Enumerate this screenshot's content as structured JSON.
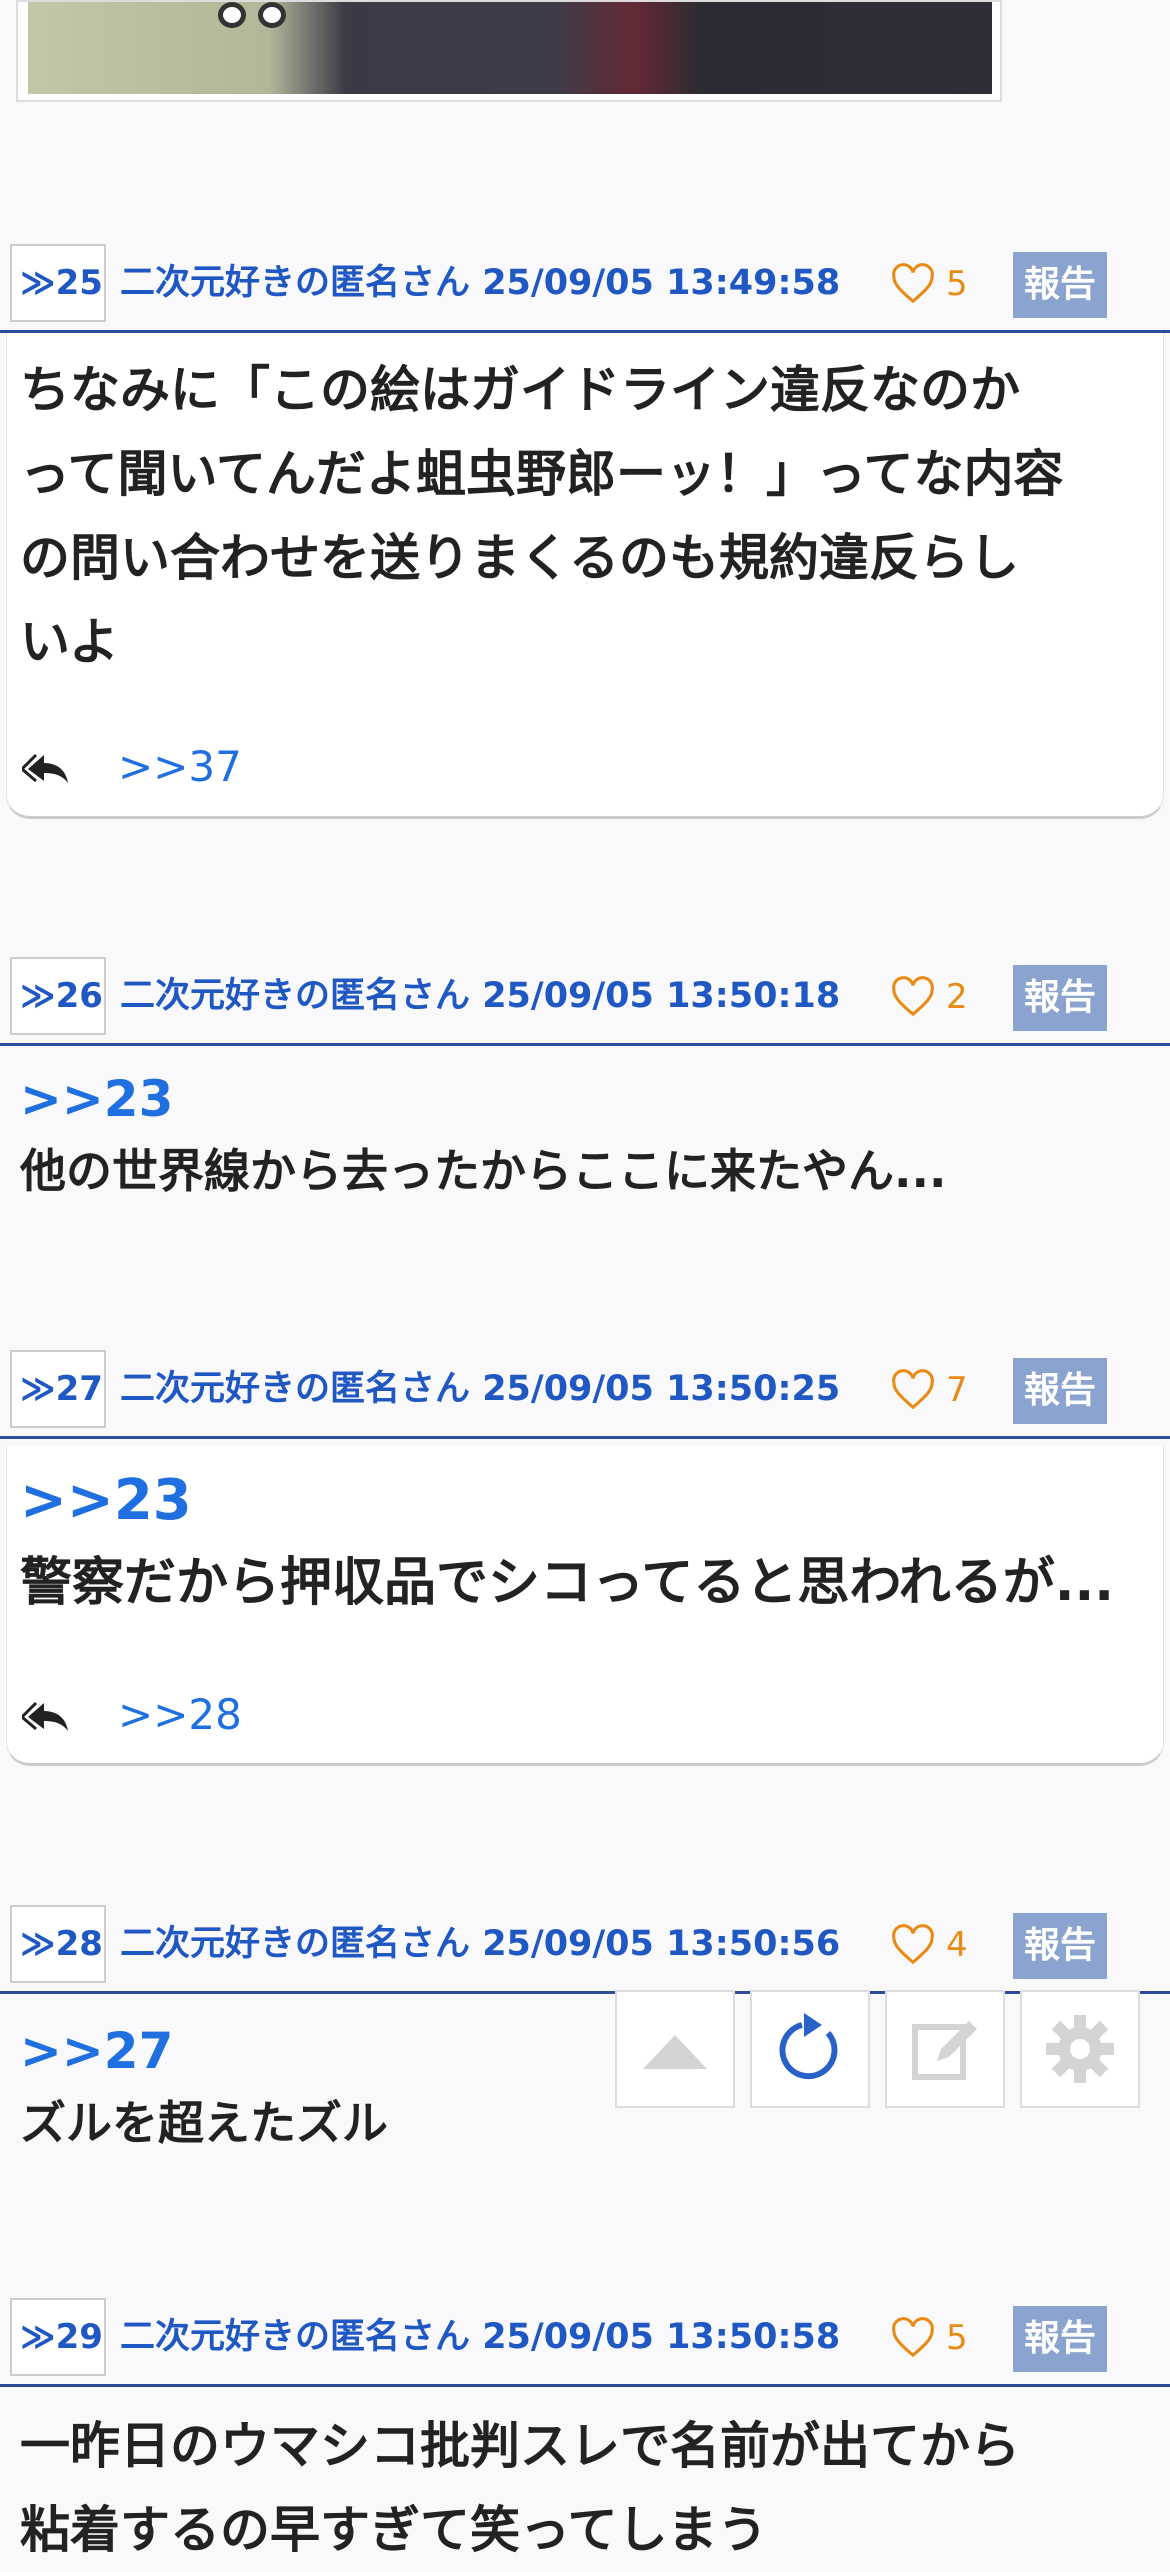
{
  "posts": [
    {
      "num": "≫25",
      "author": "二次元好きの匿名さん",
      "date": "25/09/05 13:49:58",
      "likes": "5",
      "report": "報告",
      "lines": [
        "ちなみに「この絵はガイドライン違反なのか",
        "って聞いてんだよ蛆虫野郎ーッ！」ってな内容",
        "の問い合わせを送りまくるのも規約違反らし",
        "いよ"
      ],
      "reply_link": ">>37"
    },
    {
      "num": "≫26",
      "author": "二次元好きの匿名さん",
      "date": "25/09/05 13:50:18",
      "likes": "2",
      "report": "報告",
      "anchor": ">>23",
      "lines": [
        "他の世界線から去ったからここに来たやん..."
      ]
    },
    {
      "num": "≫27",
      "author": "二次元好きの匿名さん",
      "date": "25/09/05 13:50:25",
      "likes": "7",
      "report": "報告",
      "anchor": ">>23",
      "lines": [
        "警察だから押収品でシコってると思われるが..."
      ],
      "reply_link": ">>28"
    },
    {
      "num": "≫28",
      "author": "二次元好きの匿名さん",
      "date": "25/09/05 13:50:56",
      "likes": "4",
      "report": "報告",
      "anchor": ">>27",
      "lines": [
        "ズルを超えたズル"
      ]
    },
    {
      "num": "≫29",
      "author": "二次元好きの匿名さん",
      "date": "25/09/05 13:50:58",
      "likes": "5",
      "report": "報告",
      "lines": [
        "一昨日のウマシコ批判スレで名前が出てから",
        "粘着するの早すぎて笑ってしまう"
      ]
    }
  ],
  "floating_buttons": [
    "scroll-top",
    "reload",
    "compose",
    "settings"
  ],
  "colors": {
    "accent": "#1f57c3",
    "link": "#1f6fe0",
    "like": "#e88a14",
    "report_bg": "#8aa4cf",
    "rule": "#2b4c9c"
  }
}
